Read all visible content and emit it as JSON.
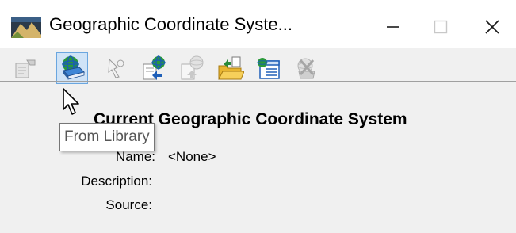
{
  "window": {
    "title": "Geographic Coordinate Syste...",
    "controls": {
      "minimize_icon": "minimize-icon",
      "maximize_icon": "maximize-icon",
      "close_icon": "close-icon"
    }
  },
  "toolbar": {
    "buttons": [
      {
        "icon": "properties-icon",
        "state": "disabled"
      },
      {
        "icon": "from-library-icon",
        "state": "hover"
      },
      {
        "icon": "select-from-map-icon",
        "state": "disabled"
      },
      {
        "icon": "export-to-library-icon",
        "state": "enabled"
      },
      {
        "icon": "import-from-file-icon",
        "state": "disabled"
      },
      {
        "icon": "export-to-file-icon",
        "state": "enabled"
      },
      {
        "icon": "list-view-icon",
        "state": "enabled"
      },
      {
        "icon": "delete-icon",
        "state": "disabled"
      }
    ]
  },
  "content": {
    "heading": "Current Geographic Coordinate System",
    "fields": [
      {
        "label": "Name:",
        "value": "<None>"
      },
      {
        "label": "Description:",
        "value": ""
      },
      {
        "label": "Source:",
        "value": ""
      }
    ]
  },
  "tooltip": {
    "text": "From Library"
  },
  "colors": {
    "hover_bg": "#cfe3f7",
    "hover_border": "#6aa6df",
    "window_bg": "#f0f0f0",
    "titlebar_bg": "#ffffff"
  }
}
